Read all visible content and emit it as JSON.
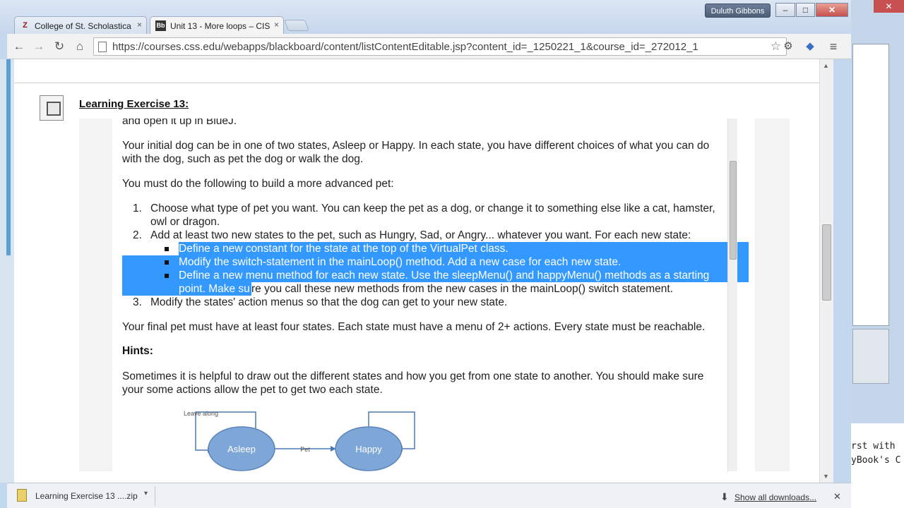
{
  "browser": {
    "tabs": [
      {
        "icon": "Z",
        "label": "College of St. Scholastica",
        "close": "×"
      },
      {
        "icon": "Bb",
        "label": "Unit 13 - More loops – CIS",
        "close": "×"
      }
    ],
    "user": "Duluth Gibbons",
    "window_buttons": {
      "minimize": "–",
      "maximize": "□",
      "close": "✕"
    },
    "url": "https://courses.css.edu/webapps/blackboard/content/listContentEditable.jsp?content_id=_1250221_1&course_id=_272012_1",
    "nav": {
      "back": "←",
      "forward": "→",
      "reload": "↻",
      "home": "⌂",
      "star": "☆",
      "menu": "≡"
    }
  },
  "exercise": {
    "title": "Learning Exercise 13:",
    "cut_line": "and open it up in BlueJ.",
    "p1": [
      "Your initial dog can be in one of two states, Asleep or Happy.  In each state, you have different choices of what you can do",
      "with the dog, such as pet the dog or walk the dog."
    ],
    "p2": "You must do the following to build a more advanced pet:",
    "list": [
      {
        "num": "1.",
        "lines": [
          "Choose what type of pet you want. You can keep the pet as a dog, or change it to something else like a cat, hamster,",
          "owl or dragon."
        ]
      },
      {
        "num": "2.",
        "lines": [
          "Add at least two new states to the pet, such as Hungry, Sad, or Angry... whatever you want. For each new state:"
        ]
      },
      {
        "num": "3.",
        "lines": [
          "Modify the states' action menus so that the dog can get to your new state."
        ]
      }
    ],
    "sub": [
      "Define a new constant for the state at the top of the VirtualPet class.",
      "Modify the switch-statement in the mainLoop() method. Add a new case for each new state.",
      "Define a new menu method for each new state. Use the sleepMenu() and happyMenu() methods as a starting"
    ],
    "sub_cont_selected": "point. Make su",
    "sub_cont_rest": "re you call these new methods from the new cases in the mainLoop() switch statement.",
    "p3": "Your final pet must have at least four states.  Each state must have a menu of 2+ actions.  Every state must be reachable.",
    "hints_heading": "Hints:",
    "p4": [
      "Sometimes it is helpful to draw out the different states and how you get from one state to another. You should make sure",
      "your some actions allow the pet to get two each state."
    ],
    "diagram": {
      "loop_label": "Leave along",
      "state_a": "Asleep",
      "edge_label": "Pet",
      "state_b": "Happy",
      "node_color": "#7ea6d6"
    }
  },
  "downloads": {
    "file": "Learning Exercise 13 ....zip",
    "dropdown": "▾",
    "show_all": "Show all downloads...",
    "close": "✕"
  },
  "background_app": {
    "code_lines": [
      "rst with",
      "yBook's C"
    ],
    "close": "✕"
  },
  "colors": {
    "selection": "#3399ff",
    "accent": "#5b9fd8"
  }
}
